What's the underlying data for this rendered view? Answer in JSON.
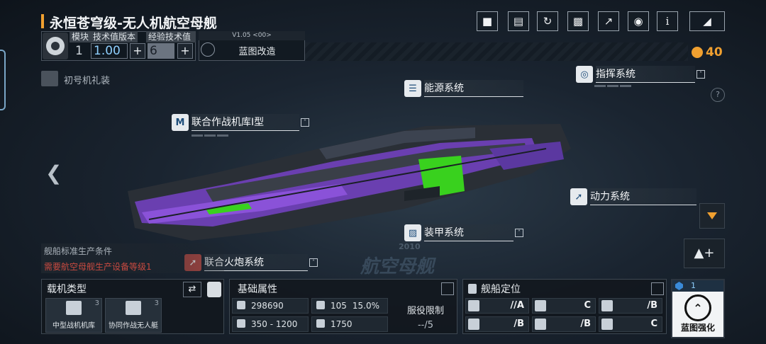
{
  "header": {
    "ship_title": "永恒苍穹级-无人机航空母舰"
  },
  "module": {
    "module_label": "模块",
    "tech_version_label": "技术值版本",
    "exp_tech_label": "经验技术值",
    "module_value": "1",
    "tech_version_value": "1.00",
    "exp_tech_value": "6"
  },
  "blueprint": {
    "version": "V1.05 <00>",
    "modify_label": "蓝图改造"
  },
  "toolbar": {
    "icons": [
      "video-icon",
      "blueprint-list-icon",
      "refresh-icon",
      "paint-spray-icon",
      "share-icon",
      "view-icon",
      "info-icon",
      "back-icon"
    ],
    "info_label": "i"
  },
  "currency": {
    "value": "40",
    "color": "#f0a030"
  },
  "paint_scheme": {
    "label": "初号机礼装"
  },
  "systems": {
    "energy": "能源系统",
    "command": "指挥系统",
    "hangar": "联合作战机库I型",
    "hangar_badge": "M",
    "power": "动力系统",
    "armor": "装甲系统",
    "artillery": "联合火炮系统"
  },
  "production": {
    "title": "舰船标准生产条件",
    "requirement": "需要航空母舰生产设备等级1"
  },
  "watermark": {
    "year": "2010",
    "type": "航空母舰"
  },
  "carrier": {
    "title": "载机类型",
    "cards": [
      {
        "label": "中型战机机库",
        "count": "3"
      },
      {
        "label": "协同作战无人艇",
        "count": "3"
      }
    ]
  },
  "attributes": {
    "title": "基础属性",
    "hp": "298690",
    "speed": "105",
    "speed_pct": "15.0%",
    "range": "350 - 1200",
    "warp": "1750",
    "service_label": "服役限制",
    "service_value": "--/5"
  },
  "role": {
    "title": "舰船定位",
    "cells": [
      "//A",
      "C",
      "/B",
      "/B",
      "/B",
      "C"
    ]
  },
  "enhance": {
    "count": "1",
    "label": "蓝图强化"
  }
}
